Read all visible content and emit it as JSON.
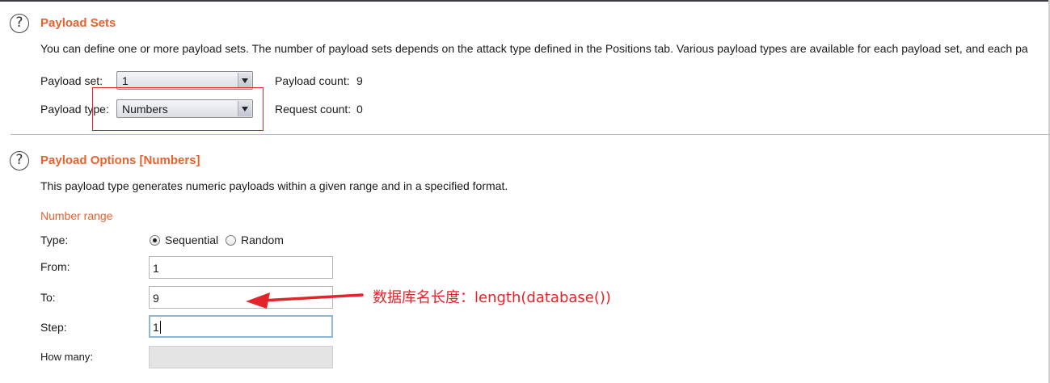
{
  "payload_sets": {
    "title": "Payload Sets",
    "description": "You can define one or more payload sets. The number of payload sets depends on the attack type defined in the Positions tab. Various payload types are available for each payload set, and each pa",
    "payload_set_label": "Payload set:",
    "payload_set_value": "1",
    "payload_type_label": "Payload type:",
    "payload_type_value": "Numbers",
    "payload_count_label": "Payload count:",
    "payload_count_value": "9",
    "request_count_label": "Request count:",
    "request_count_value": "0"
  },
  "payload_options": {
    "title": "Payload Options [Numbers]",
    "description": "This payload type generates numeric payloads within a given range and in a specified format.",
    "number_range_label": "Number range",
    "type_label": "Type:",
    "type_options": [
      "Sequential",
      "Random"
    ],
    "type_selected": "Sequential",
    "from_label": "From:",
    "from_value": "1",
    "to_label": "To:",
    "to_value": "9",
    "step_label": "Step:",
    "step_value": "1",
    "how_many_label": "How many:",
    "how_many_value": ""
  },
  "annotation": {
    "text": "数据库名长度：length(database())",
    "color": "#e3242b"
  },
  "icons": {
    "help": "?"
  },
  "colors": {
    "accent": "#e8622c",
    "annotation": "#e3242b"
  }
}
